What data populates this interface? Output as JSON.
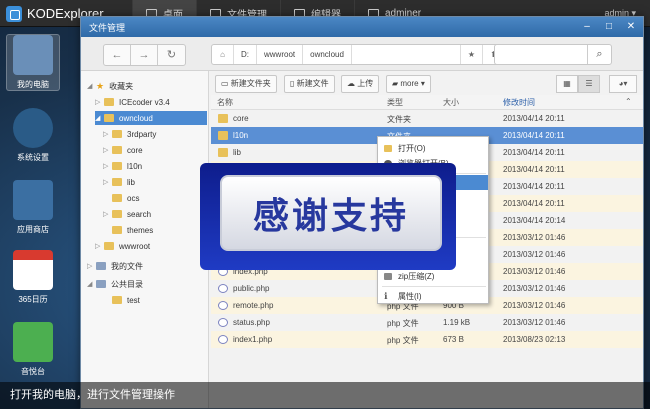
{
  "app": {
    "logo": "KODExplorer",
    "user": "admin ▾"
  },
  "topnav": [
    {
      "label": "桌面"
    },
    {
      "label": "文件管理"
    },
    {
      "label": "编辑器"
    },
    {
      "label": "adminer"
    }
  ],
  "desktop_icons": [
    {
      "label": "我的电脑",
      "color": "#6a8fb8"
    },
    {
      "label": "系统设置",
      "color": "#2a5b87"
    },
    {
      "label": "应用商店",
      "color": "#3b6fa2"
    },
    {
      "label": "365日历",
      "color": "#d83a2f"
    },
    {
      "label": "音悦台",
      "color": "#4caf50"
    }
  ],
  "window": {
    "title": "文件管理",
    "min": "–",
    "max": "□",
    "close": "✕"
  },
  "toolbar": {
    "back": "←",
    "forward": "→",
    "refresh": "↻",
    "path": [
      "D:",
      "wwwroot",
      "owncloud"
    ],
    "star": "★",
    "up": "⬆",
    "search_icon": "⌕"
  },
  "actions": {
    "new_folder": "新建文件夹",
    "new_file": "新建文件",
    "upload": "上传",
    "more": "more ▾"
  },
  "tree": [
    {
      "label": "收藏夹",
      "kind": "star"
    },
    {
      "label": "ICEcoder v3.4"
    },
    {
      "label": "owncloud"
    },
    {
      "label": "3rdparty"
    },
    {
      "label": "core"
    },
    {
      "label": "l10n"
    },
    {
      "label": "lib"
    },
    {
      "label": "ocs"
    },
    {
      "label": "search"
    },
    {
      "label": "themes"
    },
    {
      "label": "wwwroot"
    },
    {
      "label": "我的文件"
    },
    {
      "label": "公共目录"
    },
    {
      "label": "test"
    }
  ],
  "columns": {
    "name": "名称",
    "type": "类型",
    "size": "大小",
    "mtime": "修改时间"
  },
  "files": [
    {
      "name": "core",
      "type": "文件夹",
      "size": "",
      "mtime": "2013/04/14 20:11",
      "kind": "folder"
    },
    {
      "name": "l10n",
      "type": "文件夹",
      "size": "",
      "mtime": "2013/04/14 20:11",
      "kind": "folder"
    },
    {
      "name": "lib",
      "type": "",
      "size": "",
      "mtime": "2013/04/14 20:11",
      "kind": "folder"
    },
    {
      "name": "",
      "type": "",
      "size": "",
      "mtime": "2013/04/14 20:11",
      "kind": "folder"
    },
    {
      "name": "",
      "type": "",
      "size": "",
      "mtime": "2013/04/14 20:11",
      "kind": "folder"
    },
    {
      "name": "",
      "type": "",
      "size": "",
      "mtime": "2013/04/14 20:11",
      "kind": "folder"
    },
    {
      "name": "",
      "type": "",
      "size": "",
      "mtime": "2013/04/14 20:14",
      "kind": "folder"
    },
    {
      "name": "",
      "type": "",
      "size": "",
      "mtime": "2013/03/12 01:46",
      "kind": "php"
    },
    {
      "name": "",
      "type": "",
      "size": "",
      "mtime": "2013/03/12 01:46",
      "kind": "php"
    },
    {
      "name": "index.php",
      "type": "",
      "size": "",
      "mtime": "2013/03/12 01:46",
      "kind": "php"
    },
    {
      "name": "public.php",
      "type": "",
      "size": "",
      "mtime": "2013/03/12 01:46",
      "kind": "php"
    },
    {
      "name": "remote.php",
      "type": "php 文件",
      "size": "900 B",
      "mtime": "2013/03/12 01:46",
      "kind": "php"
    },
    {
      "name": "status.php",
      "type": "php 文件",
      "size": "1.19 kB",
      "mtime": "2013/03/12 01:46",
      "kind": "php"
    },
    {
      "name": "index1.php",
      "type": "php 文件",
      "size": "673 B",
      "mtime": "2013/08/23 02:13",
      "kind": "php"
    }
  ],
  "context_menu": {
    "open": "打开(O)",
    "open_browser": "浏览器打开(B)",
    "zip": "zip压缩(Z)",
    "properties": "属性(I)"
  },
  "banner": "感谢支持",
  "caption": "打开我的电脑，进行文件管理操作"
}
